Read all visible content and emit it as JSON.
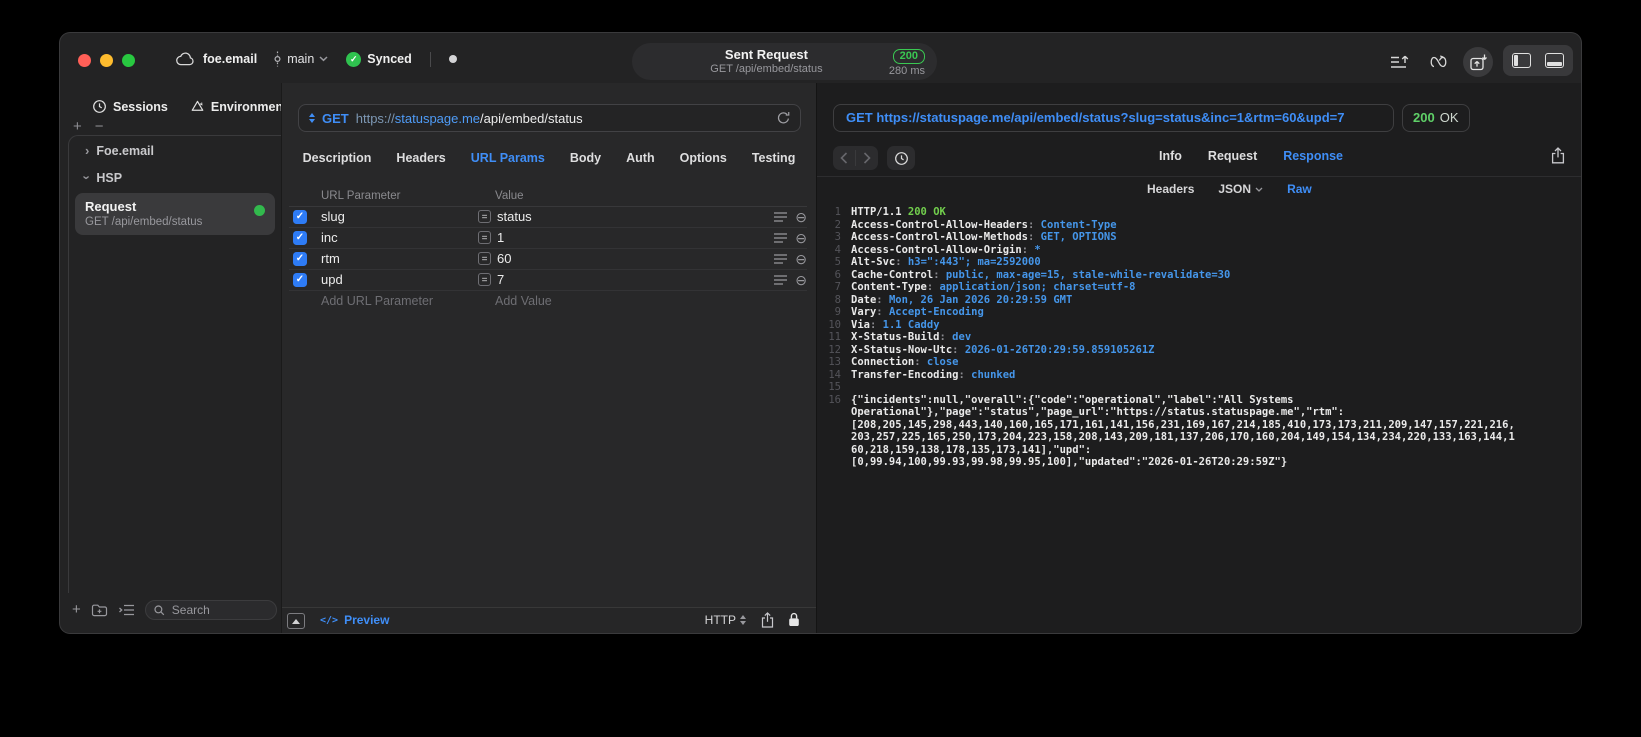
{
  "titlebar": {
    "project": "foe.email",
    "branch": "main",
    "sync_label": "Synced",
    "pill": {
      "title": "Sent Request",
      "subtitle": "GET /api/embed/status",
      "status_code": "200",
      "duration": "280 ms"
    }
  },
  "sidebar": {
    "tabs": [
      {
        "label": "Sessions",
        "icon": "history-clock-icon"
      },
      {
        "label": "Environments",
        "icon": "environments-icon"
      }
    ],
    "groups": [
      {
        "label": "Foe.email",
        "expanded": false
      },
      {
        "label": "HSP",
        "expanded": true
      }
    ],
    "request": {
      "title": "Request",
      "subtitle": "GET /api/embed/status"
    },
    "search_placeholder": "Search"
  },
  "request_editor": {
    "method": "GET",
    "url": {
      "scheme": "https://",
      "host": "statuspage.me",
      "path": "/api/embed/status"
    },
    "tabs": [
      "Description",
      "Headers",
      "URL Params",
      "Body",
      "Auth",
      "Options",
      "Testing"
    ],
    "active_tab": "URL Params",
    "table": {
      "col_param": "URL Parameter",
      "col_value": "Value",
      "rows": [
        {
          "name": "slug",
          "value": "status",
          "enabled": true
        },
        {
          "name": "inc",
          "value": "1",
          "enabled": true
        },
        {
          "name": "rtm",
          "value": "60",
          "enabled": true
        },
        {
          "name": "upd",
          "value": "7",
          "enabled": true
        }
      ],
      "add_param": "Add URL Parameter",
      "add_value": "Add Value"
    },
    "footer": {
      "preview": "Preview",
      "protocol": "HTTP"
    }
  },
  "response_viewer": {
    "request_line": "GET https://statuspage.me/api/embed/status?slug=status&inc=1&rtm=60&upd=7",
    "status_badge": {
      "code": "200",
      "reason": "OK"
    },
    "tabs": [
      "Info",
      "Request",
      "Response"
    ],
    "active_tab": "Response",
    "subtabs": [
      {
        "label": "Headers",
        "dropdown": false
      },
      {
        "label": "JSON",
        "dropdown": true
      },
      {
        "label": "Raw",
        "dropdown": false
      }
    ],
    "active_subtab": "Raw",
    "status_line": {
      "protocol": "HTTP/1.1",
      "status": "200 OK"
    },
    "headers": [
      [
        "Access-Control-Allow-Headers",
        "Content-Type"
      ],
      [
        "Access-Control-Allow-Methods",
        "GET, OPTIONS"
      ],
      [
        "Access-Control-Allow-Origin",
        "*"
      ],
      [
        "Alt-Svc",
        "h3=\":443\"; ma=2592000"
      ],
      [
        "Cache-Control",
        "public, max-age=15, stale-while-revalidate=30"
      ],
      [
        "Content-Type",
        "application/json; charset=utf-8"
      ],
      [
        "Date",
        "Mon, 26 Jan 2026 20:29:59 GMT"
      ],
      [
        "Vary",
        "Accept-Encoding"
      ],
      [
        "Via",
        "1.1 Caddy"
      ],
      [
        "X-Status-Build",
        "dev"
      ],
      [
        "X-Status-Now-Utc",
        "2026-01-26T20:29:59.859105261Z"
      ],
      [
        "Connection",
        "close"
      ],
      [
        "Transfer-Encoding",
        "chunked"
      ]
    ],
    "body_lines": [
      "{\"incidents\":null,\"overall\":{\"code\":\"operational\",\"label\":\"All Systems",
      "Operational\"},\"page\":\"status\",\"page_url\":\"https://status.statuspage.me\",\"rtm\":",
      "[208,205,145,298,443,140,160,165,171,161,141,156,231,169,167,214,185,410,173,173,211,209,147,157,221,216,",
      "203,257,225,165,250,173,204,223,158,208,143,209,181,137,206,170,160,204,149,154,134,234,220,133,163,144,1",
      "60,218,159,138,178,135,173,141],\"upd\":",
      "[0,99.94,100,99.93,99.98,99.95,100],\"updated\":\"2026-01-26T20:29:59Z\"}"
    ]
  },
  "colors": {
    "accent_blue": "#3f8ef7",
    "status_green": "#3ac852",
    "checkbox_blue": "#2e7cf6"
  }
}
